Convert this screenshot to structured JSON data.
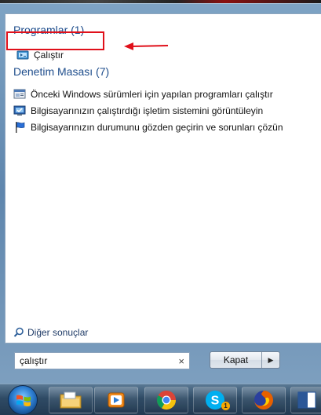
{
  "programs": {
    "header": "Programlar (1)",
    "items": [
      {
        "label": "Çalıştır",
        "icon": "run-icon"
      }
    ]
  },
  "control_panel": {
    "header": "Denetim Masası (7)",
    "items": [
      {
        "label": "Önceki Windows sürümleri için yapılan programları çalıştır",
        "icon": "compatibility-icon"
      },
      {
        "label": "Bilgisayarınızın çalıştırdığı işletim sistemini görüntüleyin",
        "icon": "system-info-icon"
      },
      {
        "label": "Bilgisayarınızın durumunu gözden geçirin ve sorunları çözün",
        "icon": "action-center-flag-icon"
      }
    ]
  },
  "more_results": "Diğer sonuçlar",
  "search": {
    "value": "çalıştır",
    "clear_glyph": "×"
  },
  "shutdown": {
    "label": "Kapat",
    "caret": "▶"
  },
  "taskbar": {
    "skype_badge": "1",
    "word_label": "W"
  },
  "colors": {
    "header_blue": "#1e4d8c",
    "highlight_red": "#e0101a",
    "taskbar": "#2f4b65"
  }
}
